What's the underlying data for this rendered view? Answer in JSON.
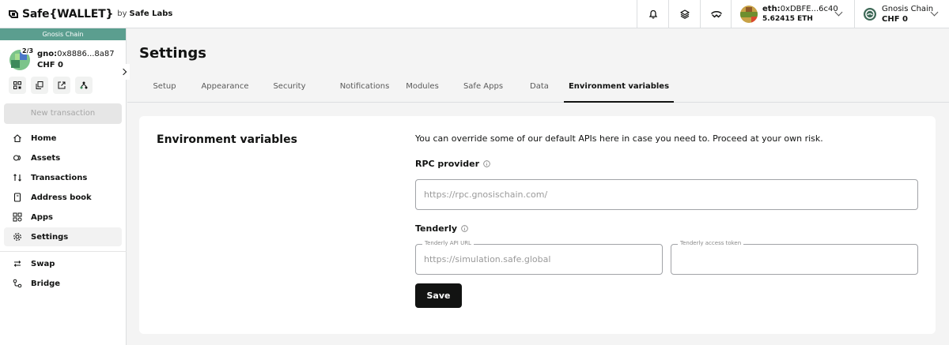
{
  "app": {
    "logo_text": "Safe{WALLET}",
    "logo_by": "by",
    "logo_labs": "Safe Labs"
  },
  "header": {
    "account": {
      "prefix": "eth:",
      "address": "0xDBFE...6c40",
      "balance": "5.62415 ETH"
    },
    "network": {
      "name": "Gnosis Chain",
      "balance": "CHF 0"
    },
    "icons": [
      "bell-icon",
      "layers-icon",
      "swap-wave-icon"
    ]
  },
  "sidebar": {
    "chain_banner": "Gnosis Chain",
    "chain_color": "#5b9e8f",
    "safe": {
      "threshold": "2/3",
      "prefix": "gno:",
      "address": "0x8886...8a87",
      "balance": "CHF 0"
    },
    "quick_actions": [
      "qr-code-icon",
      "copy-icon",
      "external-link-icon",
      "tree-icon"
    ],
    "new_transaction_label": "New transaction",
    "nav": [
      {
        "label": "Home",
        "icon": "home-icon"
      },
      {
        "label": "Assets",
        "icon": "assets-icon"
      },
      {
        "label": "Transactions",
        "icon": "transactions-icon"
      },
      {
        "label": "Address book",
        "icon": "address-book-icon"
      },
      {
        "label": "Apps",
        "icon": "apps-icon"
      },
      {
        "label": "Settings",
        "icon": "settings-icon",
        "active": true
      },
      {
        "label": "Swap",
        "icon": "swap-icon"
      },
      {
        "label": "Bridge",
        "icon": "bridge-icon"
      }
    ]
  },
  "main": {
    "title": "Settings",
    "tabs": [
      {
        "label": "Setup"
      },
      {
        "label": "Appearance"
      },
      {
        "label": "Security"
      },
      {
        "label": "Notifications"
      },
      {
        "label": "Modules"
      },
      {
        "label": "Safe Apps"
      },
      {
        "label": "Data"
      },
      {
        "label": "Environment variables",
        "active": true
      }
    ],
    "card": {
      "title": "Environment variables",
      "description": "You can override some of our default APIs here in case you need to. Proceed at your own risk.",
      "rpc": {
        "label": "RPC provider",
        "placeholder": "https://rpc.gnosischain.com/",
        "value": ""
      },
      "tenderly": {
        "label": "Tenderly",
        "api_url_label": "Tenderly API URL",
        "api_url_placeholder": "https://simulation.safe.global",
        "api_url_value": "",
        "token_label": "Tenderly access token",
        "token_value": ""
      },
      "save_label": "Save"
    }
  }
}
